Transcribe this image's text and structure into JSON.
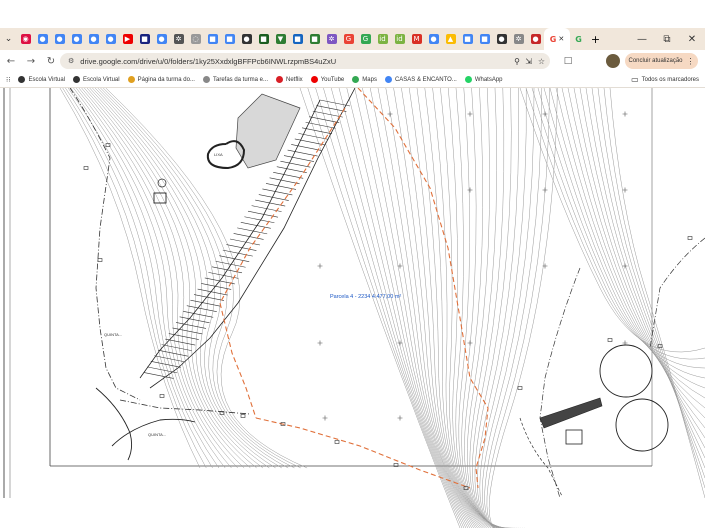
{
  "tabs": {
    "favicons": [
      {
        "name": "tab-list-icon",
        "color": "#5f6368",
        "glyph": "⌄"
      },
      {
        "name": "tab-chrome-icon",
        "color": "#d14",
        "glyph": "◉"
      },
      {
        "name": "tab-classroom-icon",
        "color": "#4285f4",
        "glyph": "●"
      },
      {
        "name": "tab-classroom-icon-2",
        "color": "#4285f4",
        "glyph": "●"
      },
      {
        "name": "tab-classroom-icon-3",
        "color": "#4285f4",
        "glyph": "●"
      },
      {
        "name": "tab-classroom-icon-4",
        "color": "#4285f4",
        "glyph": "●"
      },
      {
        "name": "tab-classroom-icon-5",
        "color": "#4285f4",
        "glyph": "●"
      },
      {
        "name": "tab-youtube-icon",
        "color": "#e00",
        "glyph": "▶"
      },
      {
        "name": "tab-doc-icon",
        "color": "#1a237e",
        "glyph": "■"
      },
      {
        "name": "tab-globe-icon",
        "color": "#4285f4",
        "glyph": "●"
      },
      {
        "name": "tab-settings-icon",
        "color": "#555",
        "glyph": "✲"
      },
      {
        "name": "tab-loading-icon",
        "color": "#999",
        "glyph": "◌"
      },
      {
        "name": "tab-docs-icon",
        "color": "#4285f4",
        "glyph": "■"
      },
      {
        "name": "tab-docs-icon-2",
        "color": "#4285f4",
        "glyph": "■"
      },
      {
        "name": "tab-circle-icon",
        "color": "#333",
        "glyph": "●"
      },
      {
        "name": "tab-green-icon",
        "color": "#1b5e20",
        "glyph": "■"
      },
      {
        "name": "tab-shield-icon",
        "color": "#2e7d32",
        "glyph": "▼"
      },
      {
        "name": "tab-mail-icon",
        "color": "#1565c0",
        "glyph": "■"
      },
      {
        "name": "tab-photo-icon",
        "color": "#2e7d32",
        "glyph": "■"
      },
      {
        "name": "tab-spin-icon",
        "color": "#7e57c2",
        "glyph": "✲"
      },
      {
        "name": "tab-google-icon",
        "color": "#ea4335",
        "glyph": "G"
      },
      {
        "name": "tab-google-icon-2",
        "color": "#34a853",
        "glyph": "G"
      },
      {
        "name": "tab-id-icon",
        "color": "#7cb342",
        "glyph": "id"
      },
      {
        "name": "tab-id-icon-2",
        "color": "#7cb342",
        "glyph": "id"
      },
      {
        "name": "tab-gmail-icon",
        "color": "#d93025",
        "glyph": "M"
      },
      {
        "name": "tab-meet-icon",
        "color": "#4285f4",
        "glyph": "●"
      },
      {
        "name": "tab-drive-icon",
        "color": "#fbbc04",
        "glyph": "▲"
      },
      {
        "name": "tab-docs-icon-3",
        "color": "#4285f4",
        "glyph": "■"
      },
      {
        "name": "tab-docs-icon-4",
        "color": "#4285f4",
        "glyph": "■"
      },
      {
        "name": "tab-circle-icon-2",
        "color": "#333",
        "glyph": "●"
      },
      {
        "name": "tab-spin-icon-2",
        "color": "#888",
        "glyph": "✲"
      },
      {
        "name": "tab-red-icon",
        "color": "#c62828",
        "glyph": "●"
      }
    ],
    "active_favicon": {
      "name": "tab-active-google-icon",
      "glyph": "G"
    },
    "after_active": {
      "name": "tab-google-icon-3",
      "glyph": "G"
    },
    "new_tab": "+"
  },
  "window": {
    "minimize": "—",
    "restore": "⧉",
    "close": "✕"
  },
  "toolbar": {
    "back": "←",
    "forward": "→",
    "reload": "↻",
    "url": "drive.google.com/drive/u/0/folders/1ky25XxdxlgBFFPcb6INWLrzpmBS4uZxU",
    "update_label": "Concluir atualização"
  },
  "bookmarks": {
    "apps_icon": "⁝⁝",
    "items": [
      {
        "label": "Escola Virtual",
        "color": "#333"
      },
      {
        "label": "Escola Virtual",
        "color": "#333"
      },
      {
        "label": "Página da turma do...",
        "color": "#e0a020"
      },
      {
        "label": "Tarefas da turma e...",
        "color": "#888"
      },
      {
        "label": "Netflix",
        "color": "#d81f26"
      },
      {
        "label": "YouTube",
        "color": "#e00"
      },
      {
        "label": "Maps",
        "color": "#34a853"
      },
      {
        "label": "CASAS & ENCANTO...",
        "color": "#4285f4"
      },
      {
        "label": "WhatsApp",
        "color": "#25d366"
      }
    ],
    "all_bookmarks": "Todos os marcadores"
  },
  "drawing": {
    "parcel_label": "Parcela 4 - 2234 4.477,00 m²",
    "area_label": "LIXA",
    "quinta_1": "QUINTA...",
    "quinta_2": "QUINTA..."
  }
}
